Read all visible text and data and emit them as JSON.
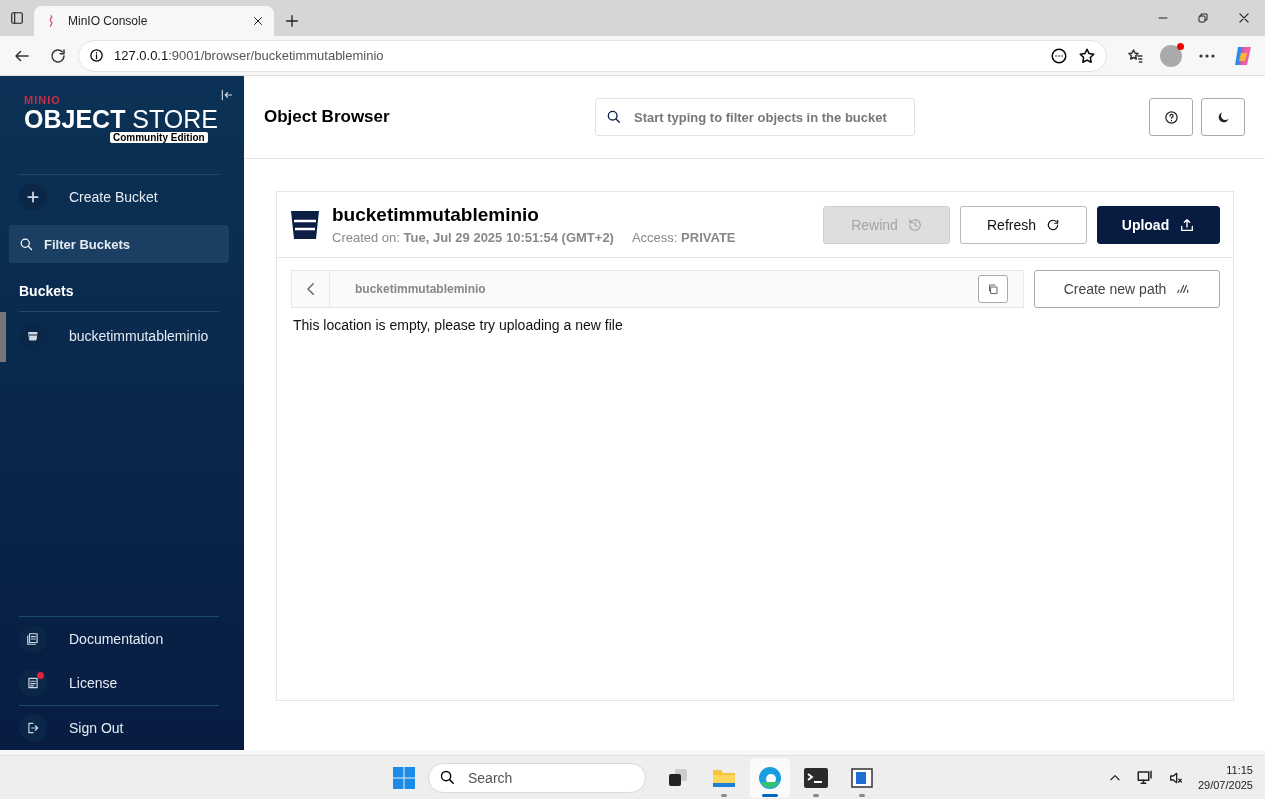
{
  "browser": {
    "tab_title": "MinIO Console",
    "url_host": "127.0.0.1",
    "url_path": ":9001/browser/bucketimmutableminio"
  },
  "sidebar": {
    "brand": {
      "vendor": "MINIO",
      "product_bold": "OBJECT",
      "product_light": "STORE",
      "edition": "Community Edition"
    },
    "create_bucket": "Create Bucket",
    "filter": {
      "placeholder": "Filter Buckets"
    },
    "buckets_heading": "Buckets",
    "buckets": [
      {
        "name": "bucketimmutableminio",
        "selected": true
      }
    ],
    "footer_items": [
      {
        "kind": "docs",
        "label": "Documentation",
        "notification": false
      },
      {
        "kind": "license",
        "label": "License",
        "notification": true
      },
      {
        "kind": "signout",
        "label": "Sign Out",
        "notification": false
      }
    ]
  },
  "header": {
    "title": "Object Browser",
    "search": {
      "placeholder": "Start typing to filter objects in the bucket"
    }
  },
  "bucket": {
    "name": "bucketimmutableminio",
    "created_label": "Created on:",
    "created_value": "Tue, Jul 29 2025 10:51:54 (GMT+2)",
    "access_label": "Access:",
    "access_value": "PRIVATE",
    "buttons": [
      {
        "kind": "rewind",
        "label": "Rewind",
        "disabled": true
      },
      {
        "kind": "refresh",
        "label": "Refresh",
        "disabled": false
      },
      {
        "kind": "upload",
        "label": "Upload",
        "disabled": false
      }
    ]
  },
  "path": {
    "crumb": "bucketimmutableminio",
    "create_path": "Create new path",
    "empty_message": "This location is empty, please try uploading a new file"
  },
  "taskbar": {
    "search": {
      "placeholder": "Search"
    },
    "apps": [
      {
        "kind": "taskview",
        "running": false,
        "selected": false
      },
      {
        "kind": "files",
        "running": true,
        "selected": false
      },
      {
        "kind": "edge",
        "running": true,
        "selected": true
      },
      {
        "kind": "terminal",
        "running": true,
        "selected": false
      },
      {
        "kind": "window",
        "running": true,
        "selected": false
      }
    ],
    "time": "11:15",
    "date": "29/07/2025"
  }
}
